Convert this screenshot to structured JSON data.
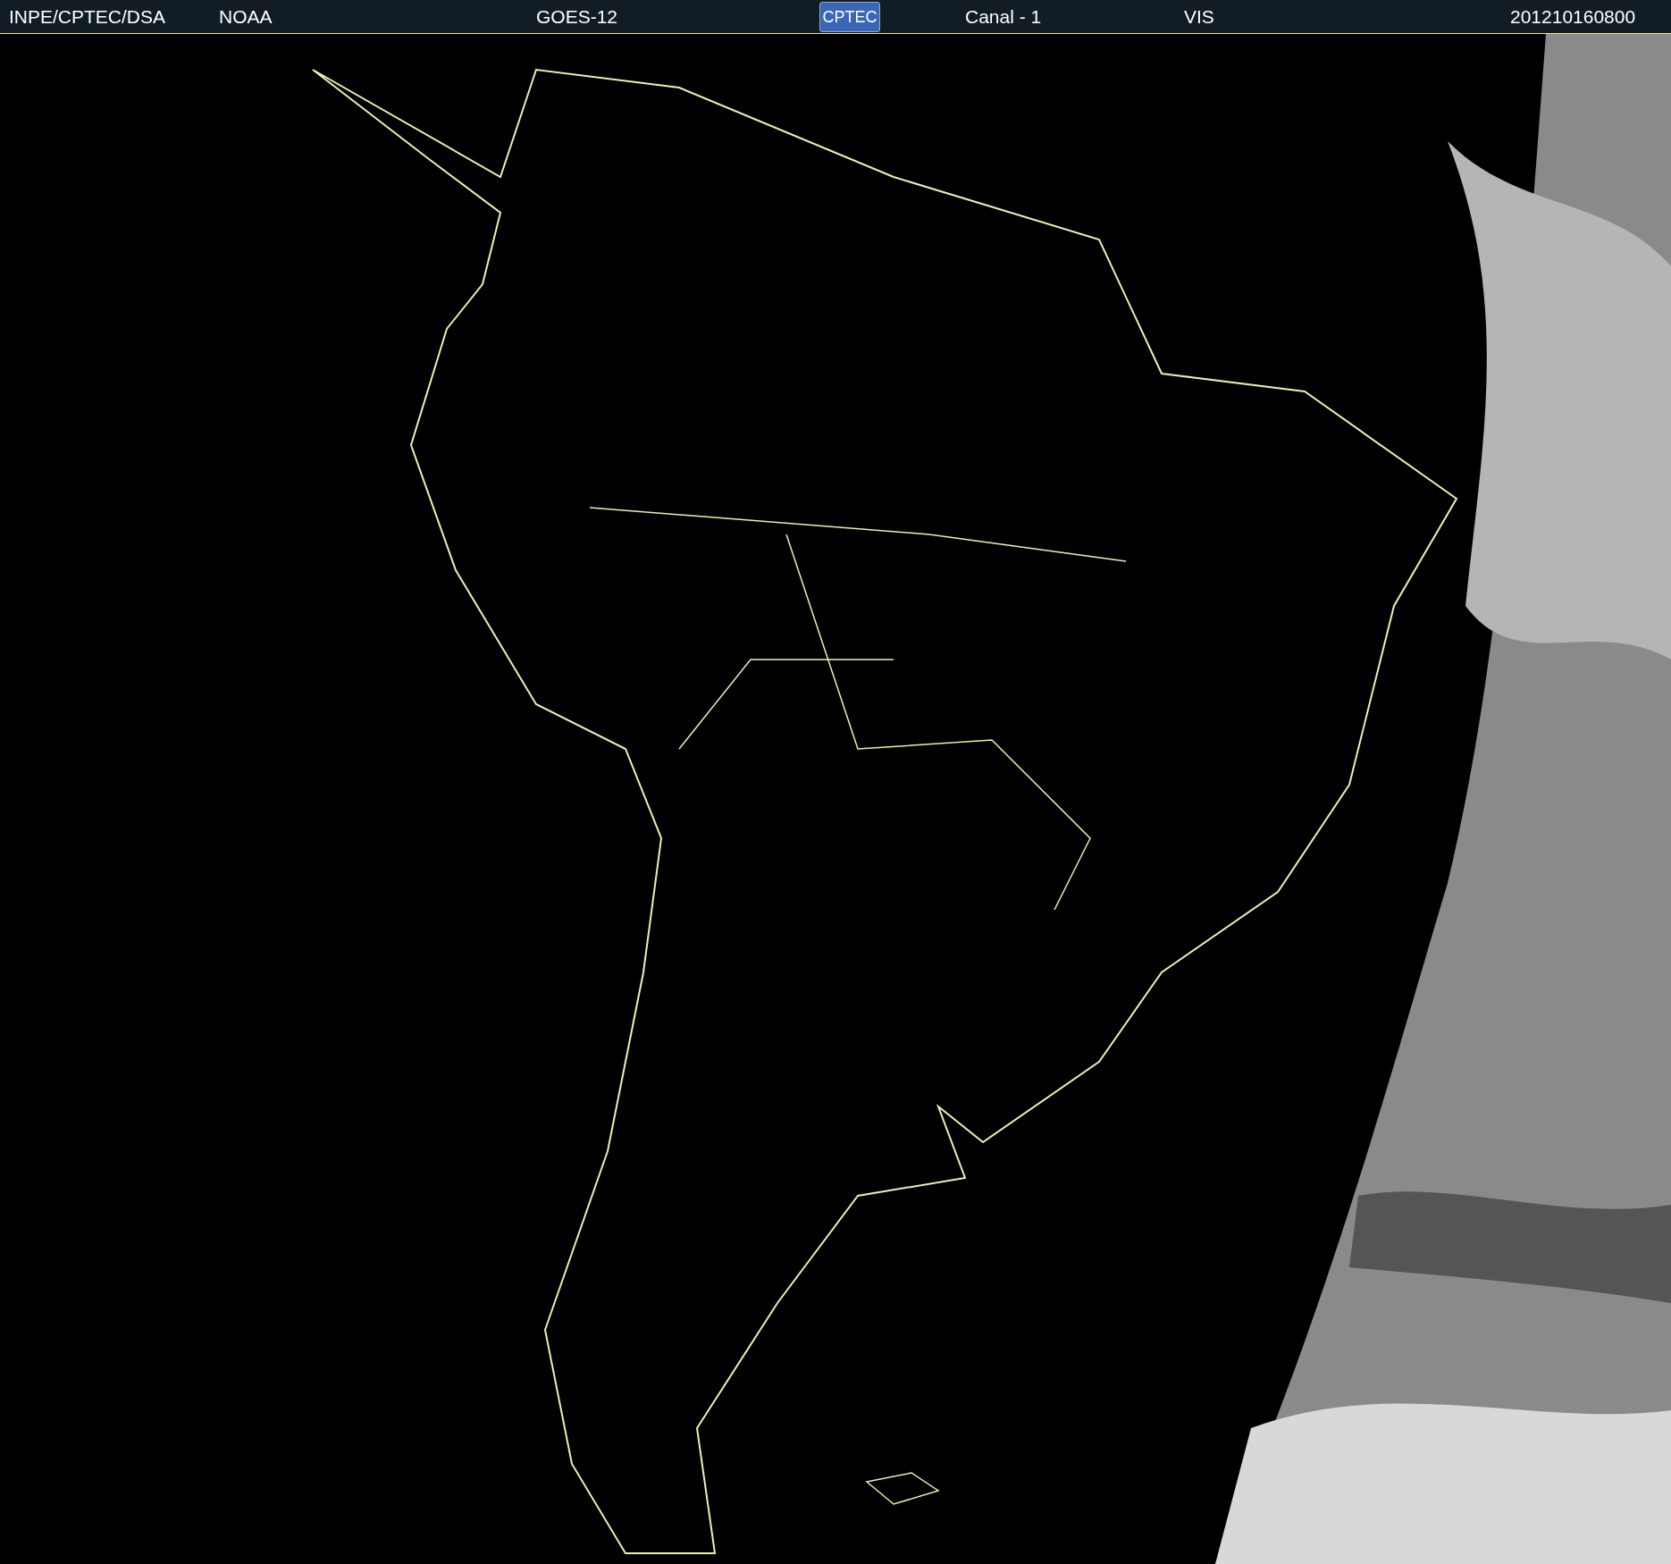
{
  "header": {
    "source": "INPE/CPTEC/DSA",
    "agency": "NOAA",
    "satellite": "GOES-12",
    "logo": "CPTEC",
    "channel": "Canal - 1",
    "band": "VIS",
    "timestamp": "201210160800"
  }
}
